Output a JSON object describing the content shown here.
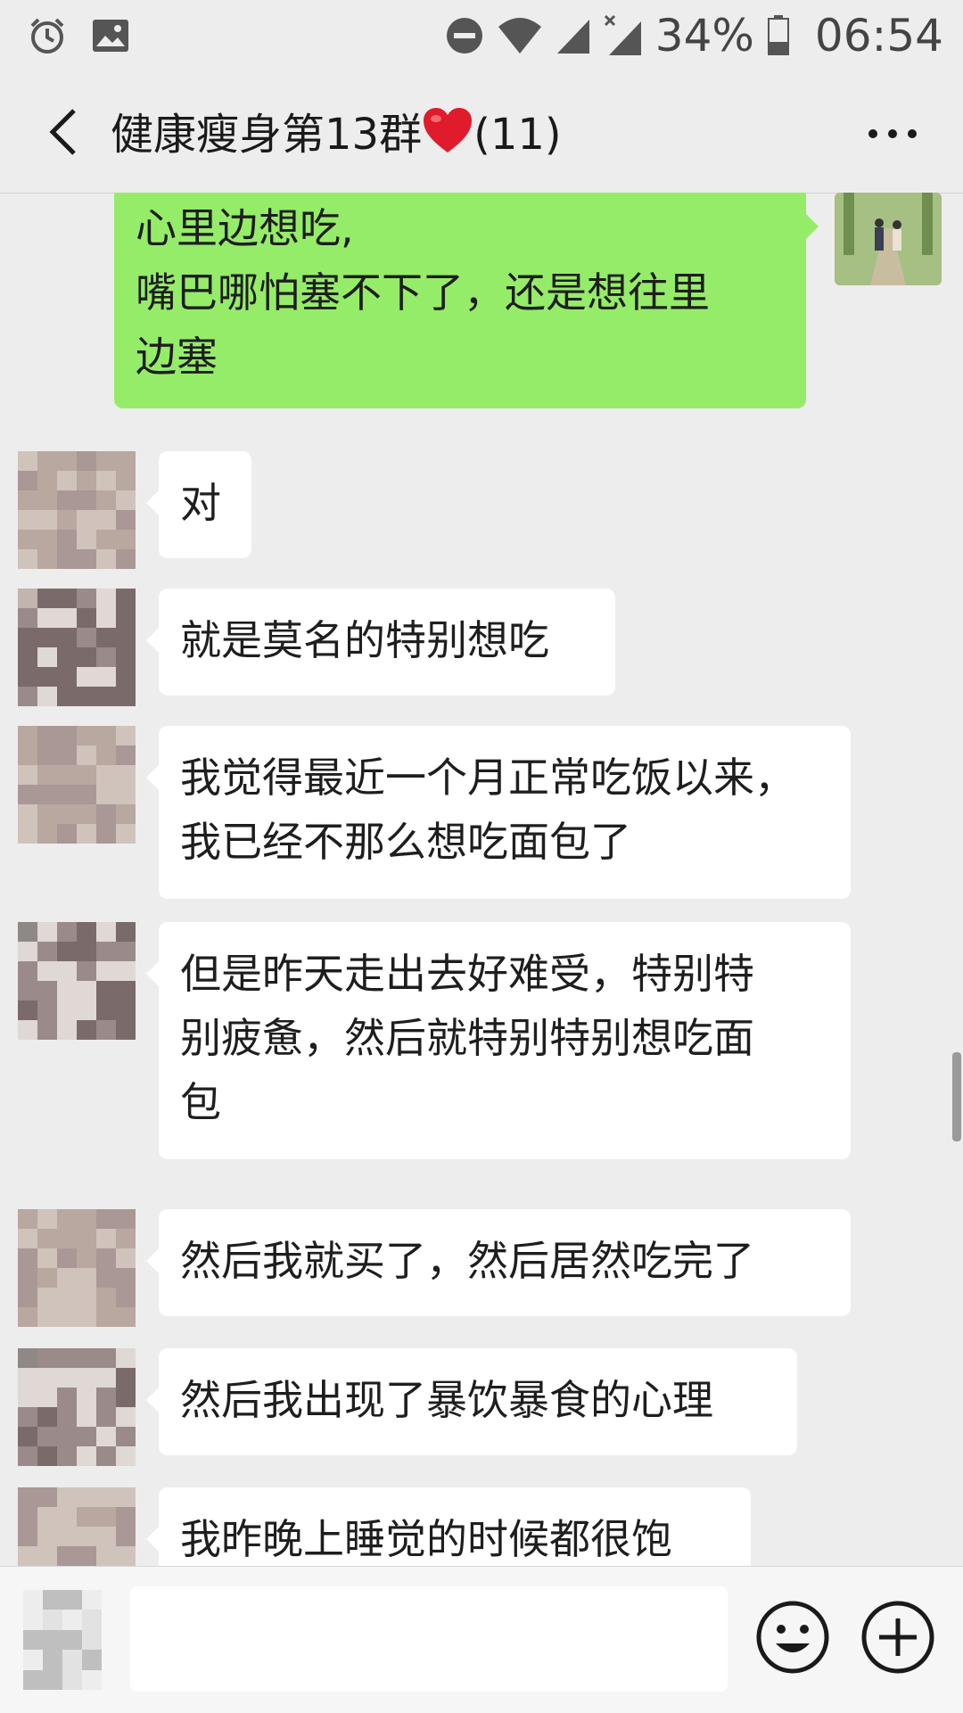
{
  "status_bar": {
    "battery": "34%",
    "time": "06:54",
    "icons": [
      "alarm-icon",
      "image-icon",
      "do-not-disturb-icon",
      "wifi-icon",
      "signal-icon",
      "signal-no-sim-icon",
      "battery-icon"
    ]
  },
  "header": {
    "title": "健康瘦身第13群",
    "member_count": "(11)",
    "back_icon": "chevron-left-icon",
    "more_icon": "more-dots-icon",
    "heart_icon": "heart-icon"
  },
  "messages": [
    {
      "sender": "self",
      "text": "心里边想吃,\n嘴巴哪怕塞不下了，还是想往里\n边塞"
    },
    {
      "sender": "other",
      "text": "对"
    },
    {
      "sender": "other",
      "text": "就是莫名的特别想吃"
    },
    {
      "sender": "other",
      "text": "我觉得最近一个月正常吃饭以来，\n我已经不那么想吃面包了"
    },
    {
      "sender": "other",
      "text": "但是昨天走出去好难受，特别特\n别疲惫，然后就特别特别想吃面\n包"
    },
    {
      "sender": "other",
      "text": "然后我就买了，然后居然吃完了"
    },
    {
      "sender": "other",
      "text": "然后我出现了暴饮暴食的心理"
    },
    {
      "sender": "other",
      "text": "我昨晚上睡觉的时候都很饱"
    }
  ],
  "input_bar": {
    "input_value": "",
    "emoji_icon": "emoji-icon",
    "plus_icon": "plus-icon"
  },
  "colors": {
    "self_bubble": "#95ec69",
    "other_bubble": "#ffffff",
    "background": "#ededed"
  }
}
